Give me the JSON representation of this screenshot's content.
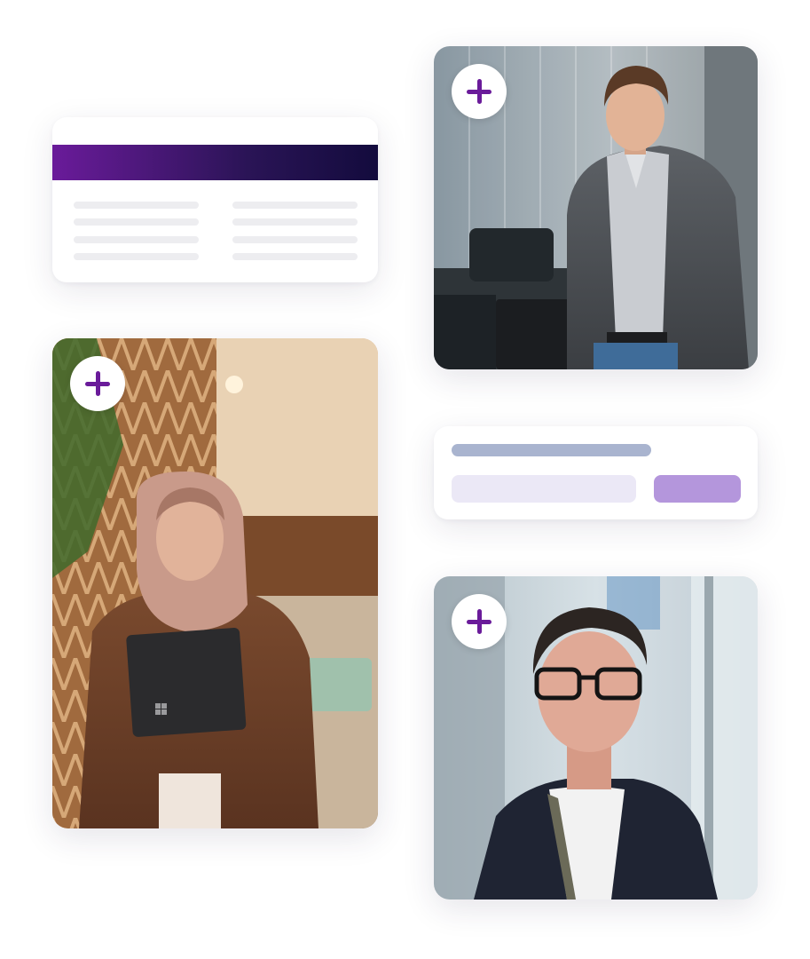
{
  "colors": {
    "accent": "#6a1b9a",
    "header_gradient_start": "#6a1b9a",
    "header_gradient_end": "#130b3d",
    "skeleton_line": "#ededf0",
    "form_label_bar": "#a9b4cf",
    "form_input": "#ebe8f6",
    "form_button": "#b496dc"
  },
  "photos": [
    {
      "name": "man-in-grey-blazer",
      "add_icon": "plus-icon"
    },
    {
      "name": "woman-with-laptop",
      "add_icon": "plus-icon"
    },
    {
      "name": "man-with-glasses",
      "add_icon": "plus-icon"
    }
  ],
  "table_card": {
    "columns": 2,
    "rows": 4
  },
  "form_card": {
    "fields": 1,
    "buttons": 1
  }
}
